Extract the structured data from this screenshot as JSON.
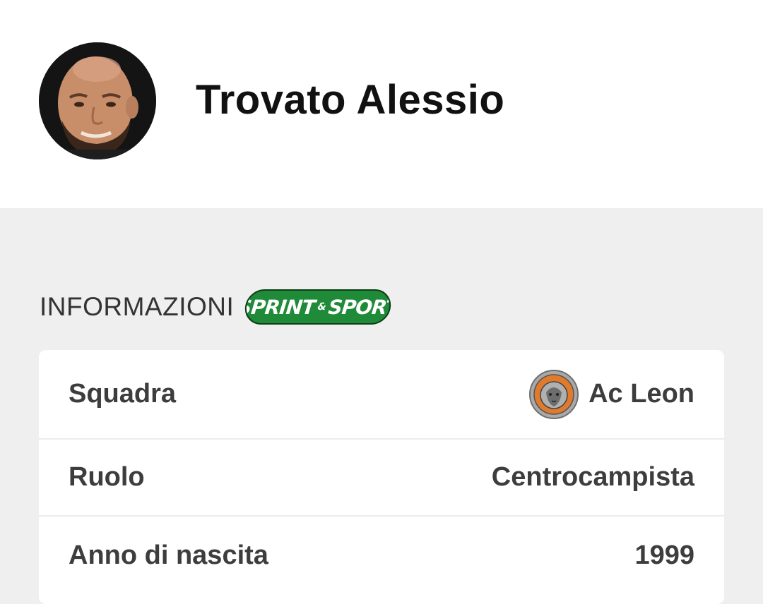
{
  "player": {
    "name": "Trovato Alessio",
    "avatar_icon": "player-photo"
  },
  "section": {
    "title": "INFORMAZIONI",
    "brand": {
      "left": "SPRINT",
      "amp": "&",
      "right": "SPORT",
      "color": "#1f8a37"
    }
  },
  "info": {
    "rows": [
      {
        "label": "Squadra",
        "value": "Ac Leon",
        "icon": "team-logo-icon"
      },
      {
        "label": "Ruolo",
        "value": "Centrocampista"
      },
      {
        "label": "Anno di nascita",
        "value": "1999"
      }
    ]
  },
  "colors": {
    "background": "#efefef",
    "card": "#ffffff",
    "text": "#3d3d3d",
    "team_logo_accent": "#e07a2c"
  }
}
